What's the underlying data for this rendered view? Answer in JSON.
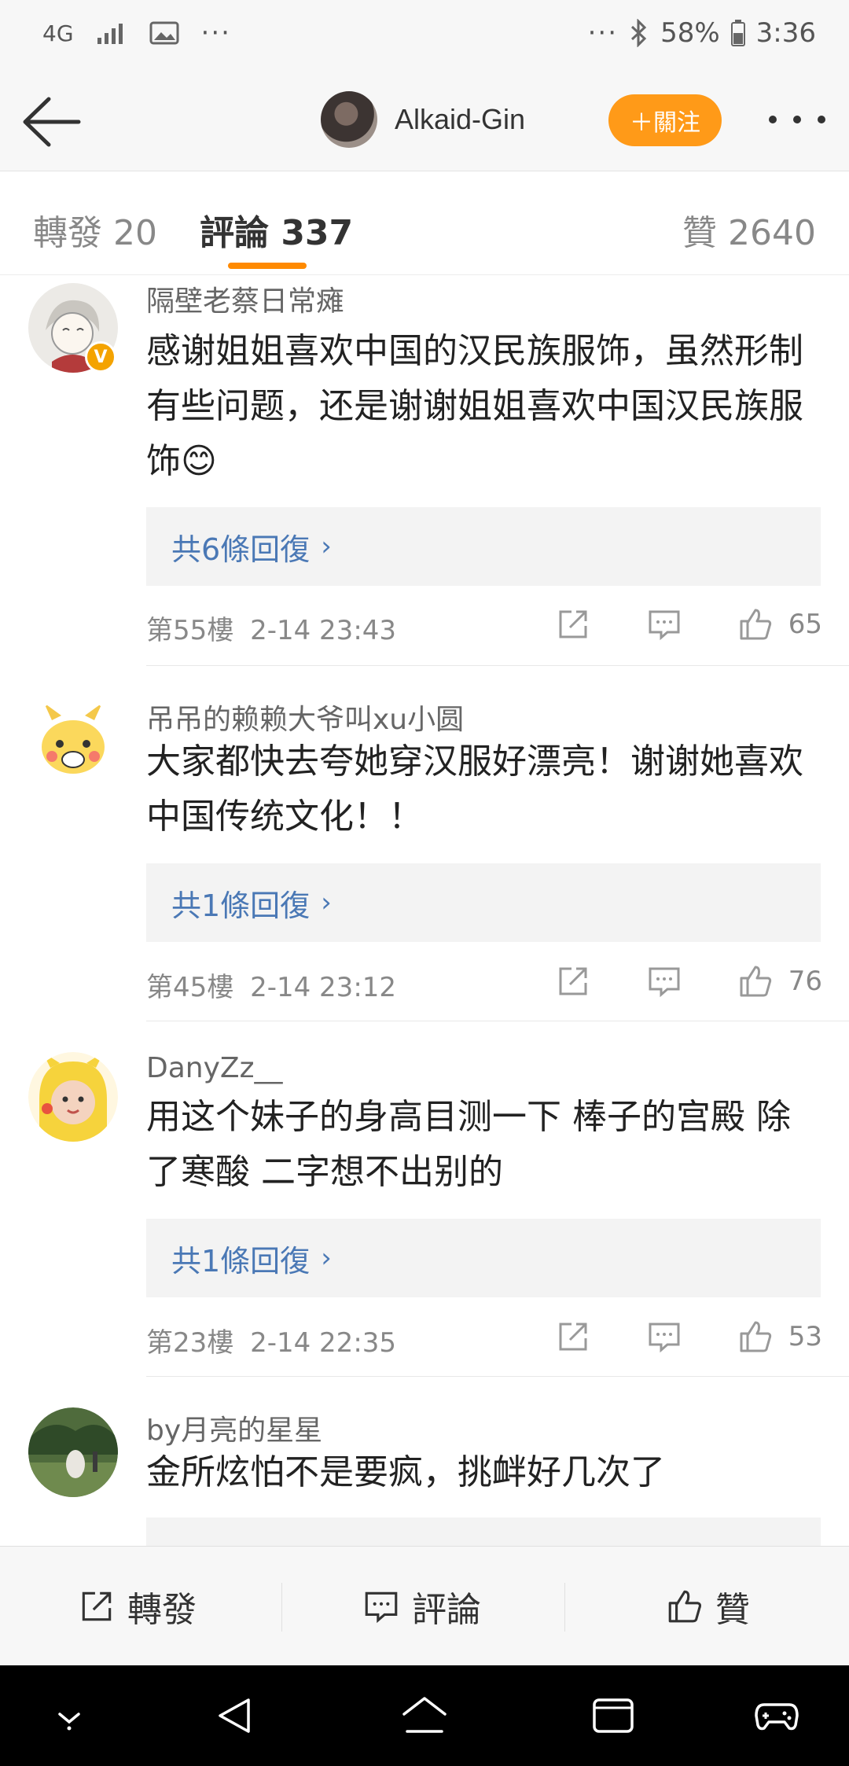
{
  "status_bar": {
    "network": "4G",
    "battery": "58%",
    "time": "3:36"
  },
  "header": {
    "username": "Alkaid-Gin",
    "follow_label": "＋關注"
  },
  "tabs": {
    "repost": "轉發 20",
    "comments": "評論 337",
    "likes": "贊 2640"
  },
  "comments": [
    {
      "username": "隔壁老蔡日常瘫",
      "text": "感谢姐姐喜欢中国的汉民族服饰，虽然形制有些问题，还是谢谢姐姐喜欢中国汉民族服饰😊",
      "replies": "共6條回復",
      "floor": "第55樓",
      "time": "2-14 23:43",
      "likes": "65"
    },
    {
      "username": "吊吊的赖赖大爷叫xu小圆",
      "text": "大家都快去夸她穿汉服好漂亮！谢谢她喜欢中国传统文化！！",
      "replies": "共1條回復",
      "floor": "第45樓",
      "time": "2-14 23:12",
      "likes": "76"
    },
    {
      "username": "DanyZz__",
      "text": "用这个妹子的身高目测一下 棒子的宫殿 除了寒酸 二字想不出别的",
      "replies": "共1條回復",
      "floor": "第23樓",
      "time": "2-14 22:35",
      "likes": "53"
    },
    {
      "username": "by月亮的星星",
      "text": "金所炫怕不是要疯，挑衅好几次了"
    }
  ],
  "bottom_bar": {
    "repost": "轉發",
    "comment": "評論",
    "like": "贊"
  },
  "colors": {
    "accent": "#ff9a18",
    "link": "#4a78b5",
    "tab_underline": "#ff8a00"
  }
}
